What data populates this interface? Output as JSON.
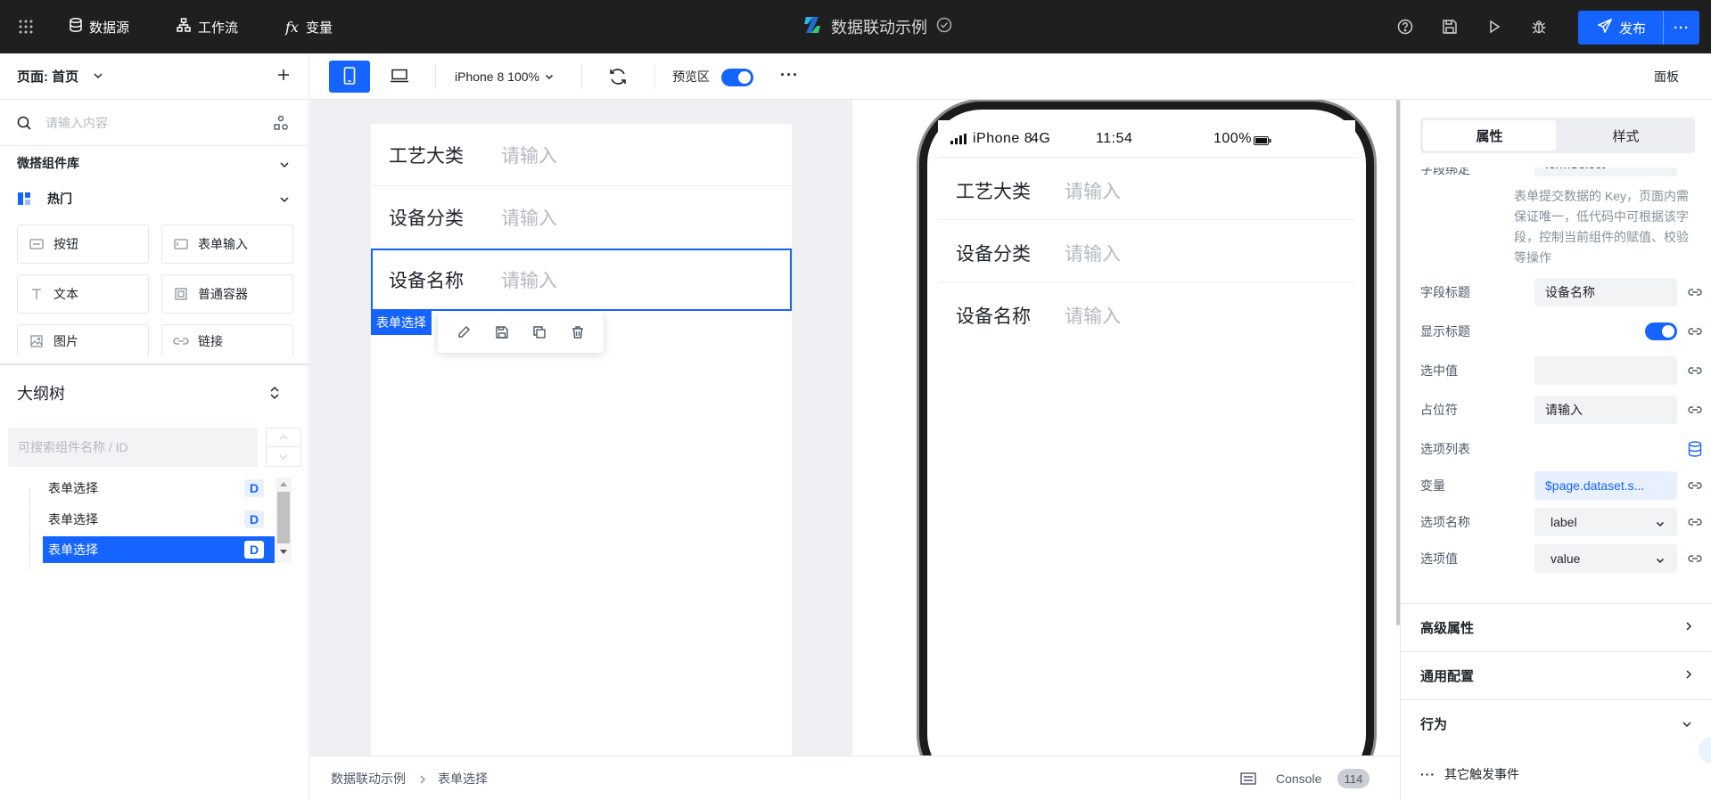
{
  "topbar": {
    "datasource": "数据源",
    "workflow": "工作流",
    "variables": "变量",
    "app_title": "数据联动示例",
    "publish": "发布"
  },
  "left": {
    "page_label": "页面: 首页",
    "search_placeholder": "请输入内容",
    "library_title": "微搭组件库",
    "hot_title": "热门",
    "components": [
      "按钮",
      "表单输入",
      "文本",
      "普通容器",
      "图片",
      "链接"
    ],
    "outline_title": "大纲树",
    "outline_search_placeholder": "可搜索组件名称 / ID",
    "tree_items": [
      {
        "label": "表单选择",
        "badge": "D",
        "selected": false
      },
      {
        "label": "表单选择",
        "badge": "D",
        "selected": false
      },
      {
        "label": "表单选择",
        "badge": "D",
        "selected": true
      }
    ]
  },
  "toolbar": {
    "device": "iPhone 8 100%",
    "preview_label": "预览区",
    "preview_on": true,
    "panel_label": "面板"
  },
  "design": {
    "rows": [
      {
        "label": "工艺大类",
        "placeholder": "请输入"
      },
      {
        "label": "设备分类",
        "placeholder": "请输入"
      },
      {
        "label": "设备名称",
        "placeholder": "请输入"
      }
    ],
    "selected_tag": "表单选择"
  },
  "phone": {
    "carrier": "iPhone 8",
    "network": "4G",
    "time": "11:54",
    "battery": "100%",
    "rows": [
      {
        "label": "工艺大类",
        "placeholder": "请输入"
      },
      {
        "label": "设备分类",
        "placeholder": "请输入"
      },
      {
        "label": "设备名称",
        "placeholder": "请输入"
      }
    ]
  },
  "bottombar": {
    "crumb_root": "数据联动示例",
    "crumb_current": "表单选择",
    "console_label": "Console",
    "console_count": "114"
  },
  "right": {
    "tab_props": "属性",
    "tab_style": "样式",
    "field_bind_label": "字段绑定",
    "field_bind_value": "formSelect",
    "field_bind_help": "表单提交数据的 Key，页面内需保证唯一，低代码中可根据该字段，控制当前组件的赋值、校验等操作",
    "props": [
      {
        "label": "字段标题",
        "value": "设备名称",
        "type": "input"
      },
      {
        "label": "显示标题",
        "value": "",
        "type": "switch"
      },
      {
        "label": "选中值",
        "value": "",
        "type": "input"
      },
      {
        "label": "占位符",
        "value": "请输入",
        "type": "input"
      },
      {
        "label": "选项列表",
        "value": "",
        "type": "db"
      },
      {
        "label": "变量",
        "value": "$page.dataset.s...",
        "type": "var"
      },
      {
        "label": "选项名称",
        "value": "label",
        "type": "select"
      },
      {
        "label": "选项值",
        "value": "value",
        "type": "select"
      }
    ],
    "sections": [
      "高级属性",
      "通用配置",
      "行为"
    ],
    "other_events": "其它触发事件"
  }
}
